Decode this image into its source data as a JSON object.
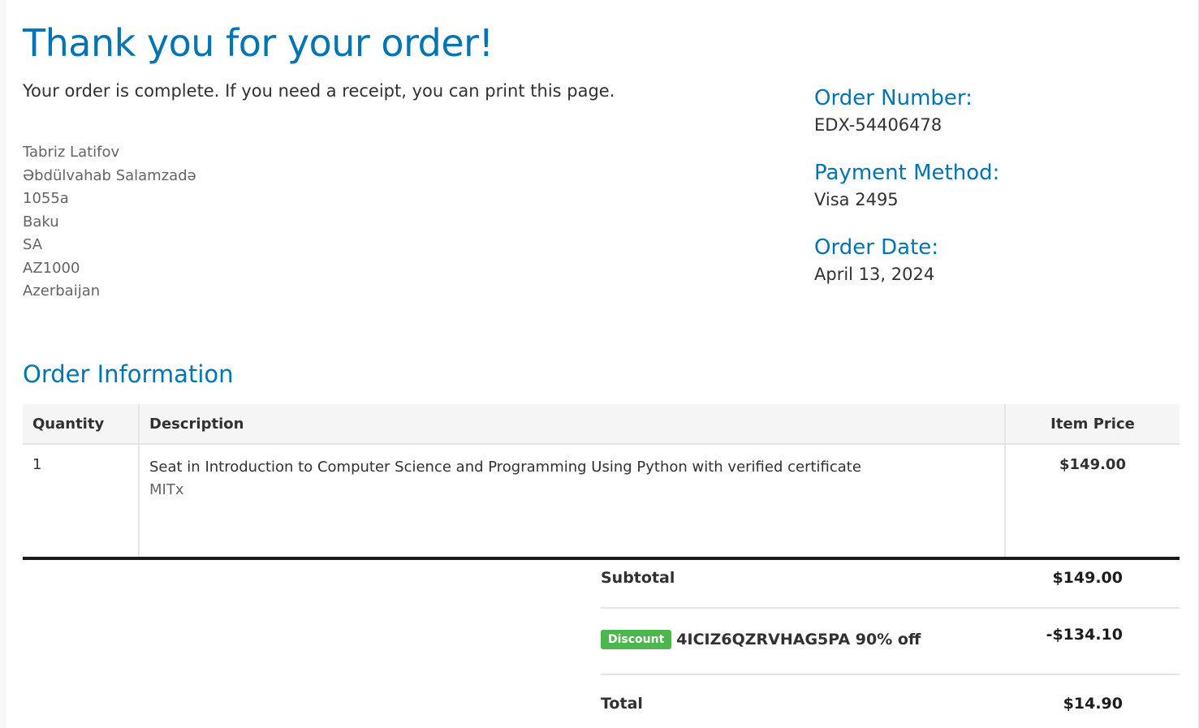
{
  "header": {
    "title": "Thank you for your order!",
    "intro": "Your order is complete. If you need a receipt, you can print this page."
  },
  "address": {
    "lines": [
      "Tabriz Latifov",
      "Əbdülvahab Salamzadə",
      "1055a",
      "Baku",
      "SA",
      "AZ1000",
      "Azerbaijan"
    ]
  },
  "order_meta": {
    "number_label": "Order Number:",
    "number": "EDX-54406478",
    "payment_label": "Payment Method:",
    "payment": "Visa 2495",
    "date_label": "Order Date:",
    "date": "April 13, 2024"
  },
  "order_info": {
    "title": "Order Information",
    "columns": {
      "quantity": "Quantity",
      "description": "Description",
      "price": "Item Price"
    },
    "items": [
      {
        "quantity": "1",
        "description": "Seat in Introduction to Computer Science and Programming Using Python with verified certificate",
        "organization": "MITx",
        "price": "$149.00"
      }
    ]
  },
  "totals": {
    "subtotal_label": "Subtotal",
    "subtotal": "$149.00",
    "discount_badge": "Discount",
    "discount_code": "4ICIZ6QZRVHAG5PA 90% off",
    "discount": "-$134.10",
    "total_label": "Total",
    "total": "$14.90"
  },
  "colors": {
    "accent": "#0075b4",
    "discount_badge": "#4cb74c"
  }
}
